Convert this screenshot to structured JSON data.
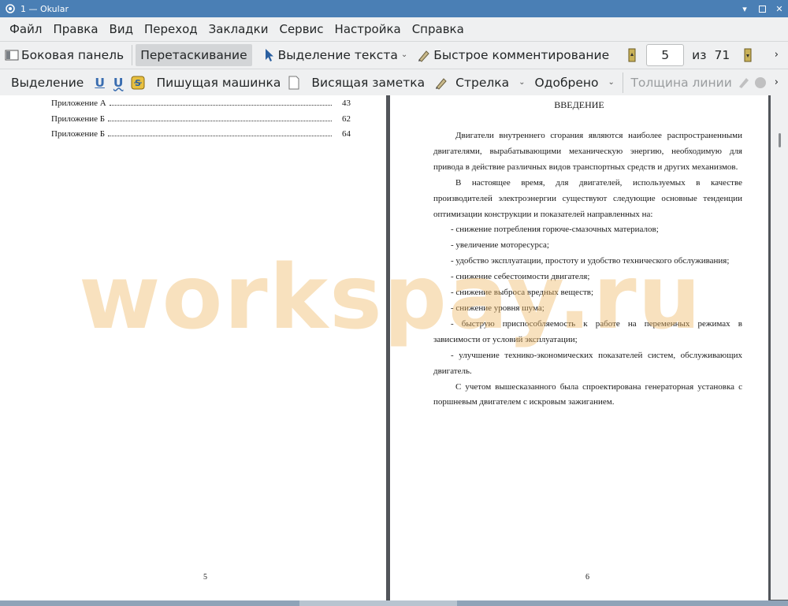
{
  "window": {
    "title": "1  — Okular",
    "icons": [
      "okular-app-icon",
      "minimize-icon",
      "maximize-icon",
      "close-icon"
    ]
  },
  "menu": [
    "Файл",
    "Правка",
    "Вид",
    "Переход",
    "Закладки",
    "Сервис",
    "Настройка",
    "Справка"
  ],
  "toolbar1": {
    "sidebar": "Боковая панель",
    "browse": "Перетаскивание",
    "text_select": "Выделение текста",
    "quick_annot": "Быстрое комментирование",
    "page_current": "5",
    "page_of": "из",
    "page_total": "71"
  },
  "toolbar2": {
    "highlight": "Выделение",
    "typewriter": "Пишущая машинка",
    "note": "Висящая заметка",
    "arrow": "Стрелка",
    "stamp": "Одобрено",
    "line_width": "Толщина линии"
  },
  "left_page": {
    "toc": [
      {
        "label": "Приложение А",
        "page": "43"
      },
      {
        "label": "Приложение Б",
        "page": "62"
      },
      {
        "label": "Приложение Б",
        "page": "64"
      }
    ],
    "page_number": "5"
  },
  "right_page": {
    "heading": "ВВЕДЕНИЕ",
    "para1": "Двигатели внутреннего сгорания являются наиболее распространенными двигателями, вырабатывающими механическую энергию, необходимую для привода в действие различных видов транспортных средств и других механизмов.",
    "para2": "В настоящее время, для двигателей, используемых в качестве производителей электроэнергии существуют следующие основные тенденции оптимизации конструкции и показателей направленных на:",
    "items": [
      "- снижение потребления горюче-смазочных материалов;",
      "- увеличение моторесурса;",
      "- удобство эксплуатации, простоту и удобство технического обслуживания;",
      "- снижение себестоимости двигателя;",
      "- снижение выброса вредных веществ;",
      "- снижение уровня шума;",
      "- быструю приспособляемость к работе на переменных режимах в зависимости от условий эксплуатации;",
      "- улучшение технико-экономических показателей систем, обслуживающих двигатель."
    ],
    "para3": "С учетом вышесказанного была спроектирована генераторная установка с поршневым двигателем с искровым зажиганием.",
    "page_number": "6"
  },
  "watermark": "workspay.ru"
}
